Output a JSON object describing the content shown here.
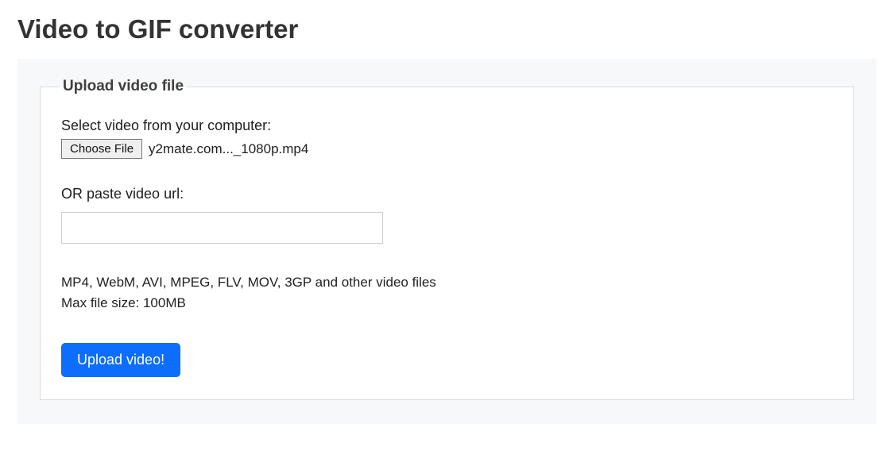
{
  "page": {
    "title": "Video to GIF converter"
  },
  "upload": {
    "legend": "Upload video file",
    "select_label": "Select video from your computer:",
    "choose_file_button": "Choose File",
    "selected_file_name": "y2mate.com..._1080p.mp4",
    "url_label": "OR paste video url:",
    "url_value": "",
    "info_formats": "MP4, WebM, AVI, MPEG, FLV, MOV, 3GP and other video files",
    "info_size": "Max file size: 100MB",
    "upload_button": "Upload video!"
  }
}
